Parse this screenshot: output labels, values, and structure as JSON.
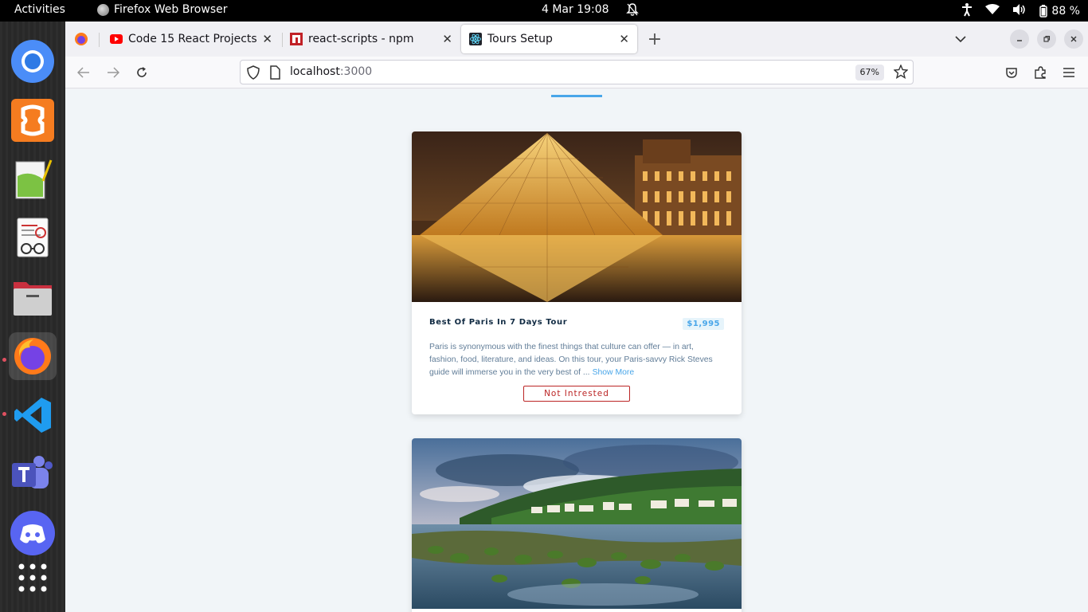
{
  "topbar": {
    "activities": "Activities",
    "app_name": "Firefox Web Browser",
    "clock": "4 Mar  19:08",
    "battery": "88 %"
  },
  "dock": {
    "apps": [
      "chromium-icon",
      "xampp-icon",
      "notepadqq-icon",
      "document-viewer-icon",
      "files-icon",
      "firefox-icon",
      "vscode-icon",
      "teams-icon",
      "discord-icon",
      "app-grid-icon"
    ]
  },
  "tabs": [
    {
      "title": "Code 15 React Projects -",
      "favicon": "youtube-icon"
    },
    {
      "title": "react-scripts - npm",
      "favicon": "npm-icon"
    },
    {
      "title": "Tours Setup",
      "favicon": "react-icon",
      "active": true
    }
  ],
  "urlbar": {
    "host": "localhost",
    "port": ":3000",
    "zoom": "67%"
  },
  "tours": [
    {
      "name": "Best Of Paris In 7 Days Tour",
      "price": "$1,995",
      "info": "Paris is synonymous with the finest things that culture can offer — in art, fashion, food, literature, and ideas. On this tour, your Paris-savvy Rick Steves guide will immerse you in the very best of ...",
      "show_more": "Show More",
      "button": "Not Intrested"
    }
  ],
  "colors": {
    "accent": "#49a6e9",
    "danger": "#bb2525",
    "title": "#102a42",
    "text": "#617d98",
    "page_bg": "#f1f5f8"
  }
}
